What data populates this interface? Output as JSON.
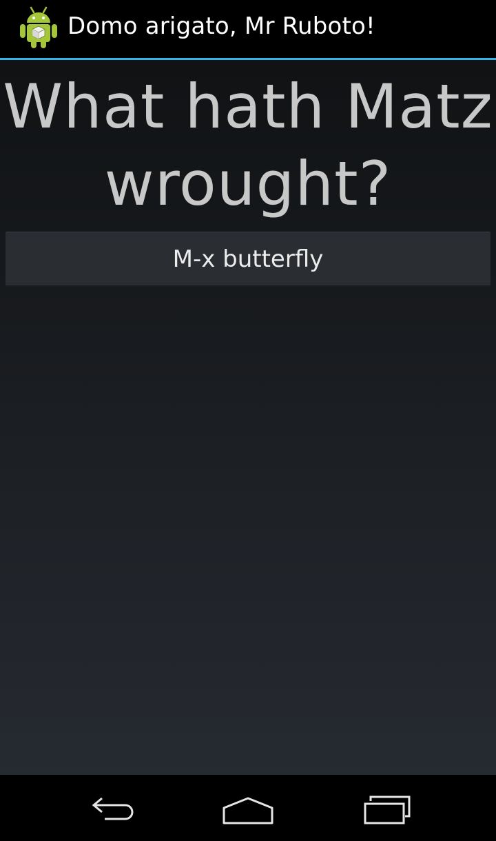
{
  "action_bar": {
    "title": "Domo arigato, Mr Ruboto!",
    "icon": "android-robot-icon",
    "accent_color": "#33b5e5"
  },
  "main": {
    "headline": "What hath Matz wrought?",
    "button_label": "M-x butterfly"
  },
  "nav_bar": {
    "back": "back-icon",
    "home": "home-icon",
    "recents": "recents-icon"
  }
}
